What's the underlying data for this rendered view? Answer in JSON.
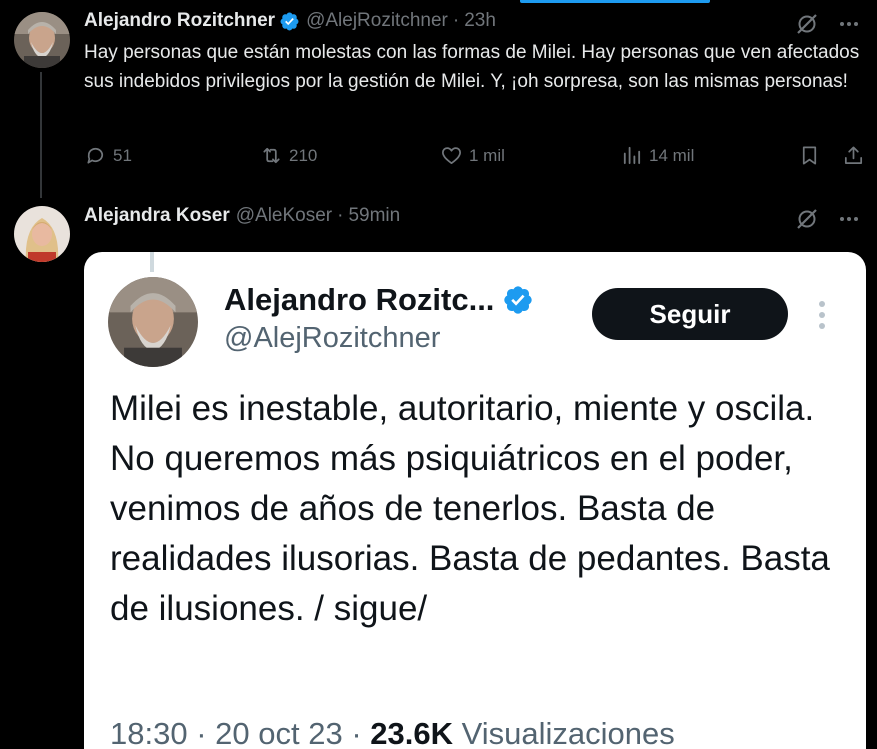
{
  "tweet1": {
    "author_name": "Alejandro Rozitchner",
    "handle": "@AlejRozitchner",
    "separator": "·",
    "time": "23h",
    "text": "Hay personas que están molestas con las formas de Milei. Hay personas que ven afectados sus indebidos privilegios por la gestión de Milei. Y, ¡oh sorpresa, son las mismas personas!",
    "replies": "51",
    "retweets": "210",
    "likes": "1 mil",
    "views": "14 mil"
  },
  "tweet2": {
    "author_name": "Alejandra Koser",
    "handle": "@AleKoser",
    "separator": "·",
    "time": "59min",
    "embedded": {
      "author_name": "Alejandro Rozitc...",
      "handle": "@AlejRozitchner",
      "follow_label": "Seguir",
      "text": "Milei es inestable, autoritario, miente y oscila. No queremos más psiquiátricos en el poder, venimos de años de tenerlos. Basta de realidades ilusorias. Basta de pedantes. Basta de ilusiones. / sigue/",
      "time": "18:30",
      "sep1": "·",
      "date": "20 oct 23",
      "sep2": "·",
      "views_count": "23.6K",
      "views_label": "Visualizaciones"
    }
  },
  "colors": {
    "background": "#000000",
    "text_primary": "#e7e9ea",
    "text_secondary": "#71767b",
    "accent": "#1d9bf0",
    "card_background": "#ffffff",
    "follow_button": "#0f1419"
  },
  "icons": {
    "verified": "verified-badge-icon",
    "grok": "grok-slash-icon",
    "more": "more-horizontal-icon",
    "reply": "reply-bubble-icon",
    "retweet": "retweet-icon",
    "like": "heart-icon",
    "views": "views-bars-icon",
    "bookmark": "bookmark-icon",
    "share": "share-upload-icon"
  }
}
